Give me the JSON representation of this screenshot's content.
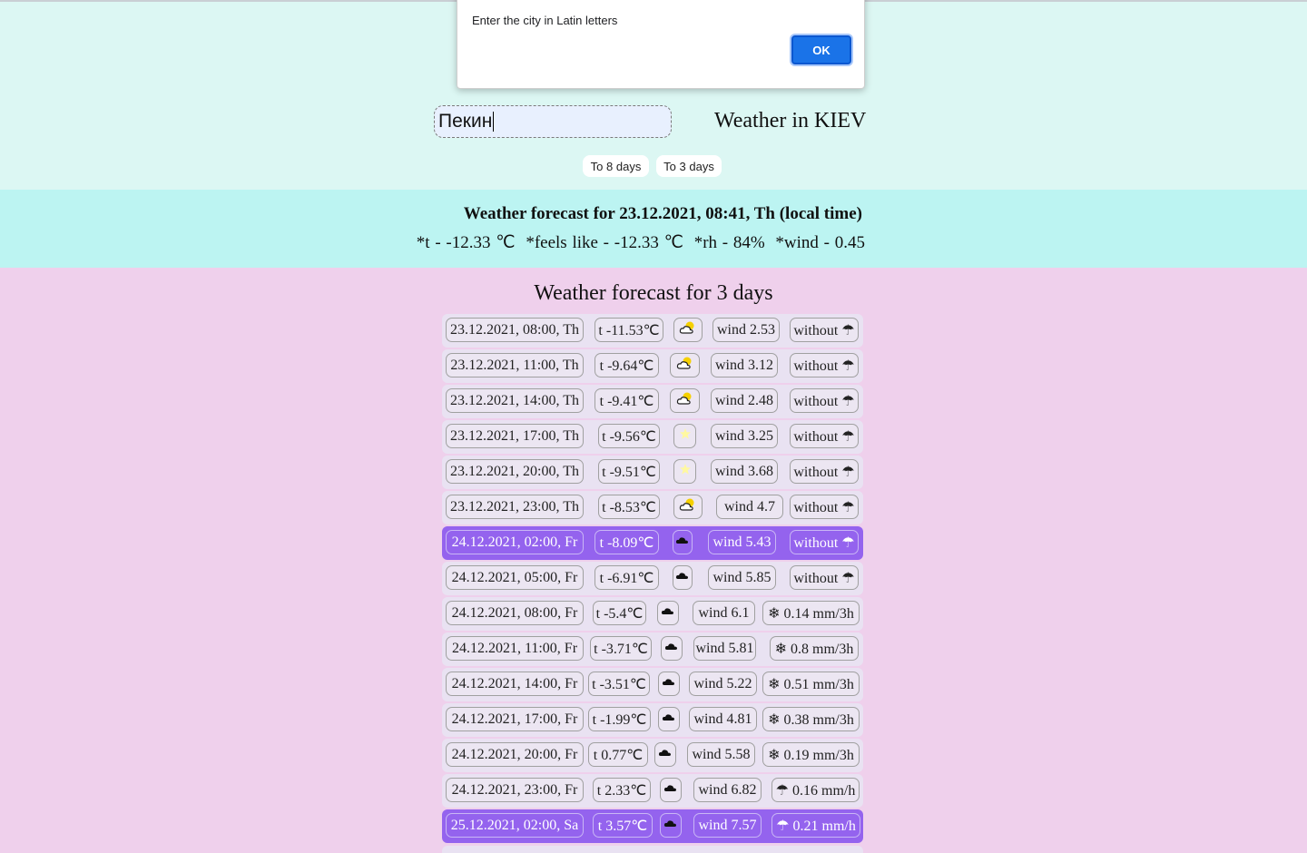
{
  "dialog": {
    "message": "Enter the city in Latin letters",
    "ok_label": "OK"
  },
  "search": {
    "value": "Пекин"
  },
  "weather_in": "Weather in KIEV",
  "buttons": {
    "to8": "To 8 days",
    "to3": "To 3 days"
  },
  "current": {
    "title": "Weather forecast for 23.12.2021, 08:41, Th (local time)",
    "temp": "*t - -12.33 ℃",
    "feels": "*feels like - -12.33 ℃",
    "rh": "*rh - 84%",
    "wind": "*wind - 0.45"
  },
  "forecast_title": "Weather forecast for 3 days",
  "rows": [
    {
      "date": "23.12.2021, 08:00, Th",
      "temp": "t -11.53℃",
      "icon": "cloud-sun-icon",
      "wind": "wind 2.53",
      "precip": "without ☂",
      "hl": false
    },
    {
      "date": "23.12.2021, 11:00, Th",
      "temp": "t -9.64℃",
      "icon": "cloud-sun-icon",
      "wind": "wind 3.12",
      "precip": "without ☂",
      "hl": false
    },
    {
      "date": "23.12.2021, 14:00, Th",
      "temp": "t -9.41℃",
      "icon": "cloud-sun-icon",
      "wind": "wind 2.48",
      "precip": "without ☂",
      "hl": false
    },
    {
      "date": "23.12.2021, 17:00, Th",
      "temp": "t -9.56℃",
      "icon": "star-icon",
      "wind": "wind 3.25",
      "precip": "without ☂",
      "hl": false
    },
    {
      "date": "23.12.2021, 20:00, Th",
      "temp": "t -9.51℃",
      "icon": "star-icon",
      "wind": "wind 3.68",
      "precip": "without ☂",
      "hl": false
    },
    {
      "date": "23.12.2021, 23:00, Th",
      "temp": "t -8.53℃",
      "icon": "cloud-sun-icon",
      "wind": "wind 4.7",
      "precip": "without ☂",
      "hl": false
    },
    {
      "date": "24.12.2021, 02:00, Fr",
      "temp": "t -8.09℃",
      "icon": "cloud-icon",
      "wind": "wind 5.43",
      "precip": "without ☂",
      "hl": true
    },
    {
      "date": "24.12.2021, 05:00, Fr",
      "temp": "t -6.91℃",
      "icon": "cloud-icon",
      "wind": "wind 5.85",
      "precip": "without ☂",
      "hl": false
    },
    {
      "date": "24.12.2021, 08:00, Fr",
      "temp": "t -5.4℃",
      "icon": "cloud-icon",
      "wind": "wind 6.1",
      "precip": "❄ 0.14 mm/3h",
      "hl": false
    },
    {
      "date": "24.12.2021, 11:00, Fr",
      "temp": "t -3.71℃",
      "icon": "cloud-icon",
      "wind": "wind 5.81",
      "precip": "❄ 0.8 mm/3h",
      "hl": false
    },
    {
      "date": "24.12.2021, 14:00, Fr",
      "temp": "t -3.51℃",
      "icon": "cloud-icon",
      "wind": "wind 5.22",
      "precip": "❄ 0.51 mm/3h",
      "hl": false
    },
    {
      "date": "24.12.2021, 17:00, Fr",
      "temp": "t -1.99℃",
      "icon": "cloud-icon",
      "wind": "wind 4.81",
      "precip": "❄ 0.38 mm/3h",
      "hl": false
    },
    {
      "date": "24.12.2021, 20:00, Fr",
      "temp": "t 0.77℃",
      "icon": "cloud-icon",
      "wind": "wind 5.58",
      "precip": "❄ 0.19 mm/3h",
      "hl": false
    },
    {
      "date": "24.12.2021, 23:00, Fr",
      "temp": "t 2.33℃",
      "icon": "cloud-icon",
      "wind": "wind 6.82",
      "precip": "☂ 0.16 mm/h",
      "hl": false
    },
    {
      "date": "25.12.2021, 02:00, Sa",
      "temp": "t 3.57℃",
      "icon": "cloud-icon",
      "wind": "wind 7.57",
      "precip": "☂ 0.21 mm/h",
      "hl": true
    }
  ],
  "colors": {
    "highlight": "#9463ee",
    "header_bg": "#dcf7f3",
    "current_bg": "#bcf4f2",
    "page_bg": "#efd0ec"
  }
}
